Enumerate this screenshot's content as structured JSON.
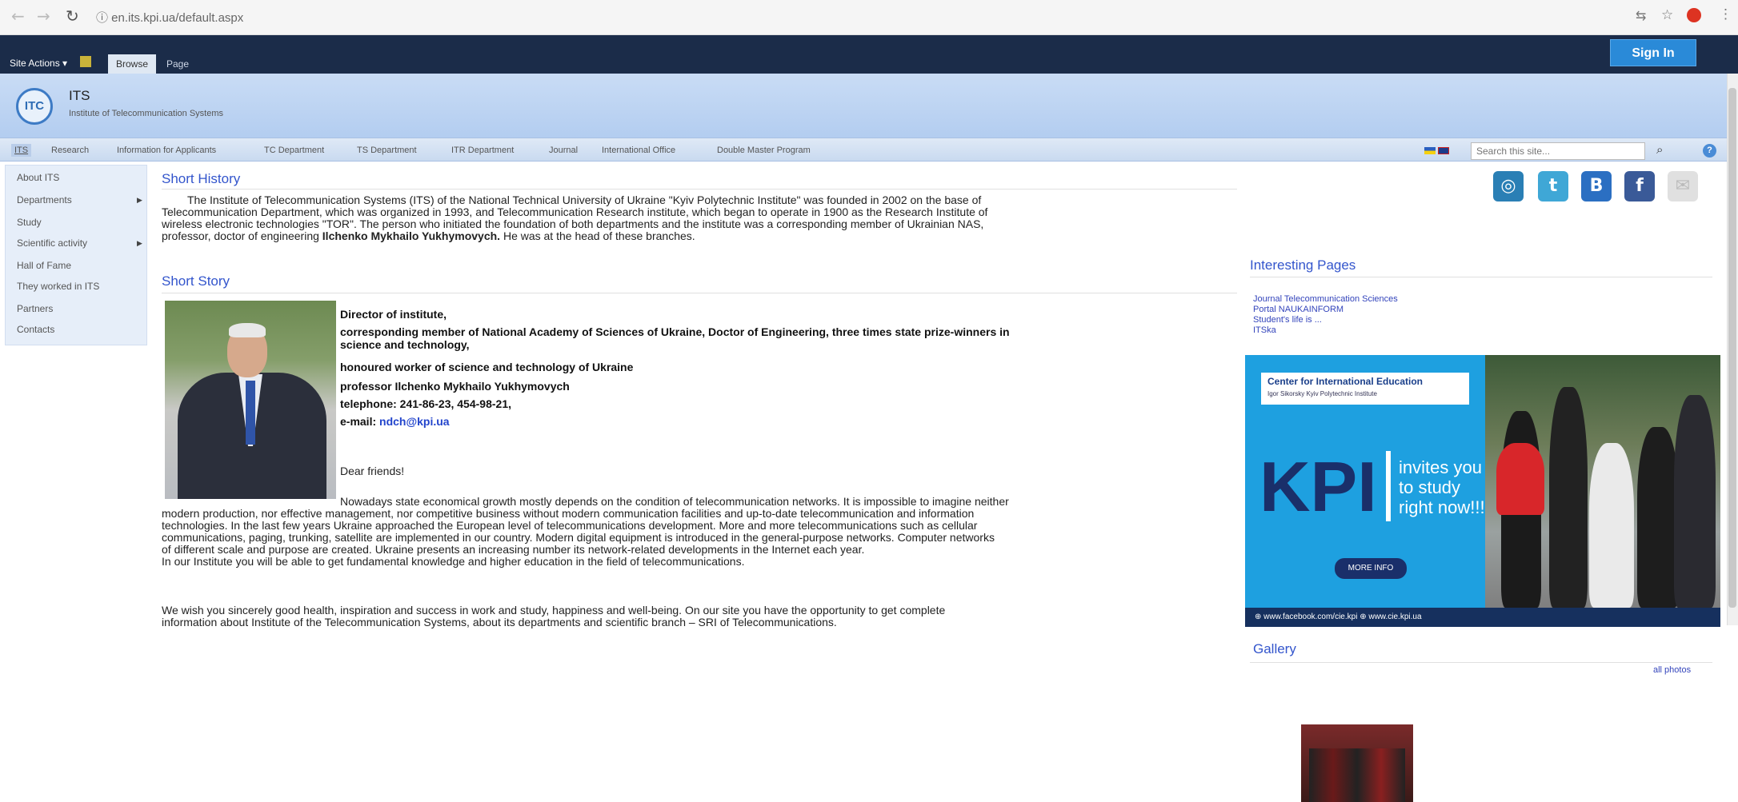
{
  "browser": {
    "url": "en.its.kpi.ua/default.aspx"
  },
  "ribbon": {
    "site_actions": "Site Actions ▾",
    "tab_browse": "Browse",
    "tab_page": "Page",
    "sign_in": "Sign In"
  },
  "header": {
    "logo_text": "ITC",
    "site_name": "ITS",
    "site_subtitle": "Institute of Telecommunication Systems"
  },
  "topnav": {
    "items": [
      "ITS",
      "Research",
      "Information for Applicants",
      "TC Department",
      "TS Department",
      "ITR Department",
      "Journal",
      "International Office",
      "Double Master Program"
    ],
    "search_placeholder": "Search this site..."
  },
  "leftnav": {
    "items": [
      "About ITS",
      "Departments",
      "Study",
      "Scientific activity",
      "Hall of Fame",
      "They worked in ITS",
      "Partners",
      "Contacts"
    ]
  },
  "main": {
    "short_history_title": "Short History",
    "history_lines": [
      "The Institute of Telecommunication Systems (ITS) of the National Technical University of Ukraine \"Kyiv Polytechnic Institute\" was founded in 2002 on the base of",
      "Telecommunication Department, which was organized in 1993, and Telecommunication Research institute, which began to operate in 1900 as the Research Institute of",
      "wireless electronic technologies \"TOR\". The person who initiated the foundation of both departments and the institute was a corresponding member of Ukrainian NAS,",
      "professor, doctor of engineering"
    ],
    "history_bold": "Ilchenko Mykhailo Yukhymovych.",
    "history_end": " He was at the head of these branches.",
    "short_story_title": "Short Story",
    "director_lines": [
      "Director of institute,",
      "corresponding member of National Academy of Sciences of Ukraine, Doctor of Engineering, three times state prize-winners in",
      "science and technology,",
      "honoured worker of science and technology of Ukraine",
      "professor Ilchenko Mykhailo Yukhymovych",
      "telephone: 241-86-23, 454-98-21,"
    ],
    "email_label": "e-mail: ",
    "email": "ndch@kpi.ua",
    "greeting": "Dear friends!",
    "body_lines": [
      "Nowadays state economical growth mostly depends on the condition of telecommunication networks. It is impossible to imagine neither",
      "modern production, nor effective management, nor competitive business without modern communication facilities and up-to-date telecommunication and information",
      "technologies. In the last few years Ukraine approached the European level of telecommunications development. More and more telecommunications such as cellular",
      "communications, paging, trunking, satellite are implemented in our country. Modern digital equipment is introduced in the general-purpose networks. Computer networks",
      "of different scale and purpose are created. Ukraine presents an increasing number its network-related developments in the Internet each year.",
      "In our Institute you will be able to get fundamental knowledge and higher education in the field of telecommunications."
    ],
    "closing_lines": [
      "We wish you sincerely good health, inspiration and success in work and study, happiness and well-being. On our site you have the opportunity to get complete",
      "information about Institute of the Telecommunication Systems, about its departments and scientific branch – SRI of Telecommunications."
    ]
  },
  "right": {
    "social": [
      {
        "name": "rss",
        "glyph": "◎",
        "color": "#2a7fb5"
      },
      {
        "name": "twitter",
        "glyph": "t",
        "color": "#3fa7d6"
      },
      {
        "name": "vkontakte",
        "glyph": "B",
        "color": "#2b6fc2"
      },
      {
        "name": "facebook",
        "glyph": "f",
        "color": "#3a5a98"
      },
      {
        "name": "mail",
        "glyph": "✉",
        "color": "#d8d8d8"
      }
    ],
    "interesting_title": "Interesting Pages",
    "interesting_links": [
      "Journal Telecommunication Sciences",
      "Portal NAUKAINFORM",
      "Student's life is ...",
      "ITSka"
    ],
    "banner": {
      "heading": "Center for International Education",
      "subheading": "Igor Sikorsky Kyiv Polytechnic Institute",
      "kpi": "KPI",
      "invite_lines": [
        "invites you",
        "to study",
        "right now!!!"
      ],
      "more_button": "MORE INFO",
      "footer": "⊕ www.facebook.com/cie.kpi    ⊕ www.cie.kpi.ua"
    },
    "gallery_title": "Gallery",
    "all_photos": "all photos"
  }
}
